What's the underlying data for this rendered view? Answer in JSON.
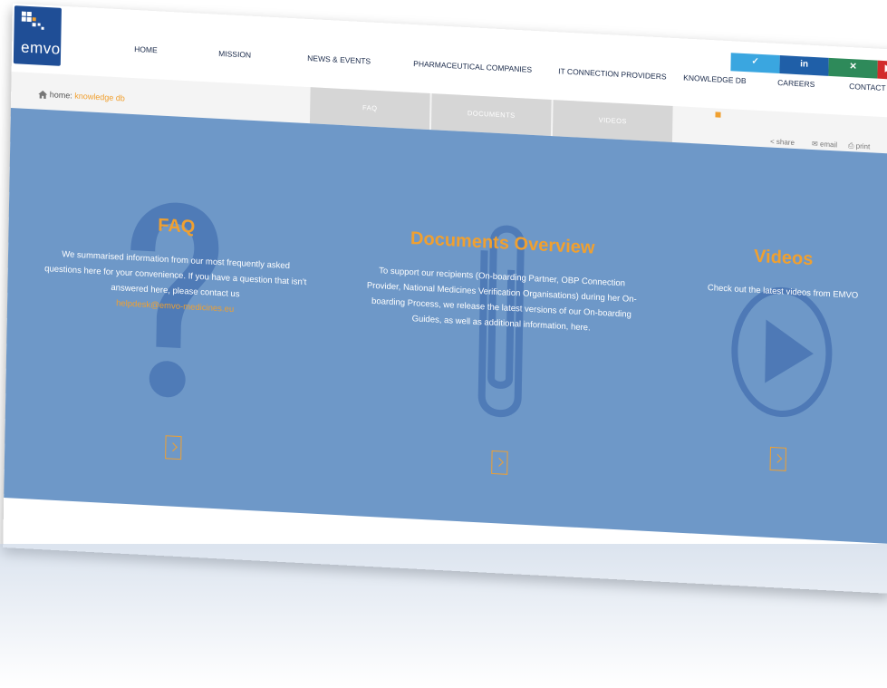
{
  "logo": {
    "text": "emvo"
  },
  "nav": {
    "items": [
      "HOME",
      "MISSION",
      "NEWS & EVENTS",
      "PHARMACEUTICAL COMPANIES",
      "IT CONNECTION PROVIDERS",
      "KNOWLEDGE DB",
      "CAREERS",
      "CONTACT"
    ],
    "active": "KNOWLEDGE DB"
  },
  "social": [
    {
      "name": "twitter-icon",
      "glyph": "❤",
      "color": "#3aa6e0"
    },
    {
      "name": "linkedin-icon",
      "glyph": "in",
      "color": "#1f5fa8"
    },
    {
      "name": "xing-icon",
      "glyph": "X",
      "color": "#2e8a5a"
    },
    {
      "name": "youtube-icon",
      "glyph": "▶",
      "color": "#d22b2b"
    }
  ],
  "breadcrumb": {
    "prefix": "home:",
    "current": "knowledge db"
  },
  "subtabs": [
    "FAQ",
    "DOCUMENTS",
    "VIDEOS"
  ],
  "tools": {
    "share": "share",
    "email": "email",
    "print": "print"
  },
  "sections": [
    {
      "title": "FAQ",
      "text": "We summarised information from our most frequently asked questions here for your convenience. If you have a question that isn't answered here, please contact us",
      "email": "helpdesk@emvo-medicines.eu"
    },
    {
      "title": "Documents Overview",
      "text": "To support our recipients (On-boarding Partner, OBP Connection Provider, National Medicines Verification Organisations) during her On-boarding Process, we release the latest versions of our On-boarding Guides, as well as additional information, here."
    },
    {
      "title": "Videos",
      "text": "Check out the latest videos from EMVO"
    }
  ],
  "colors": {
    "accent": "#f0a030",
    "hero": "#6e98c8",
    "brand": "#1f4e96"
  }
}
